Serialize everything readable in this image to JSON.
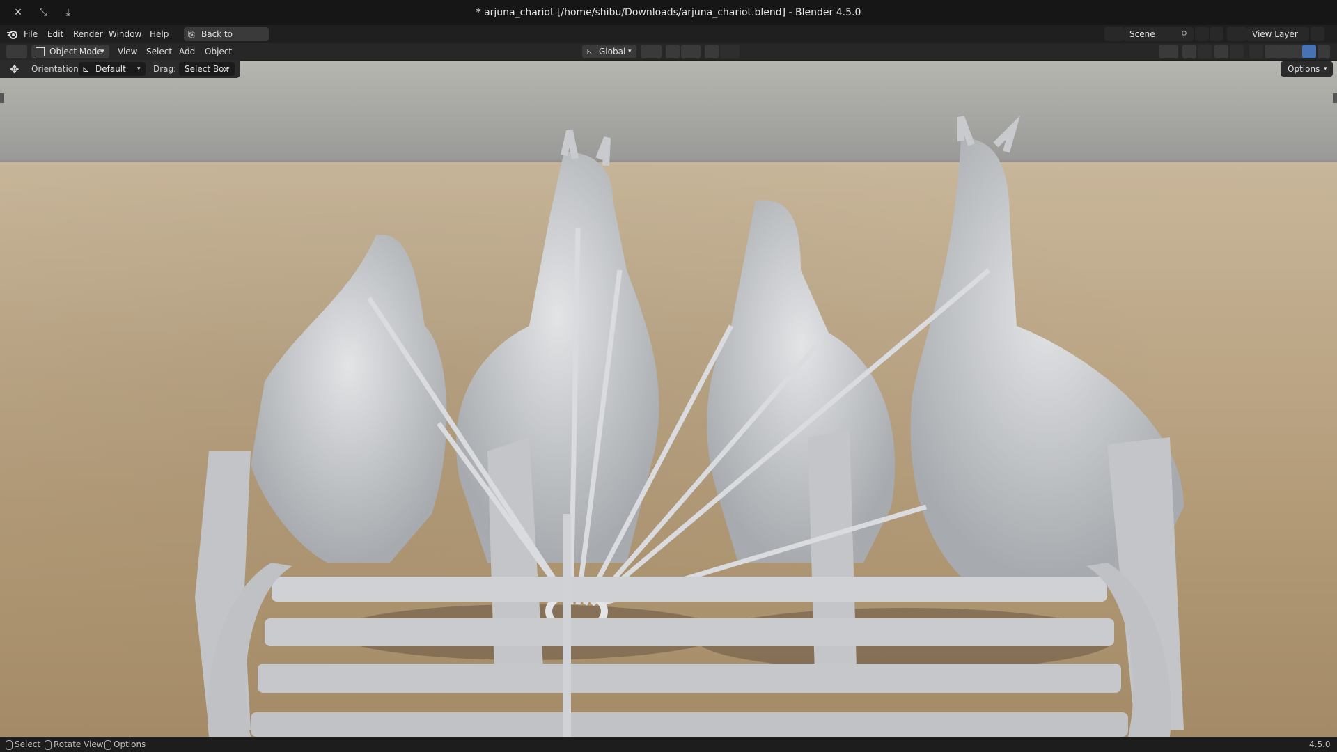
{
  "window": {
    "title": "* arjuna_chariot [/home/shibu/Downloads/arjuna_chariot.blend] - Blender 4.5.0"
  },
  "menu": {
    "items": [
      "File",
      "Edit",
      "Render",
      "Window",
      "Help"
    ],
    "back_button": "Back to Previous"
  },
  "scene": {
    "name": "Scene",
    "view_layer": "View Layer"
  },
  "header": {
    "mode": "Object Mode",
    "menus": [
      "View",
      "Select",
      "Add",
      "Object"
    ],
    "transform_orientation": "Global"
  },
  "tool_settings": {
    "orientation_label": "Orientation:",
    "orientation_value": "Default",
    "drag_label": "Drag:",
    "drag_value": "Select Box"
  },
  "options_label": "Options",
  "status": {
    "select": "Select",
    "rotate": "Rotate View",
    "options": "Options",
    "version": "4.5.0"
  },
  "icons": [
    "blender-logo-icon",
    "close-icon",
    "minimize-icon",
    "maximize-icon",
    "editor-type-icon",
    "move-tool-icon",
    "snap-icon",
    "proportional-icon",
    "shading-icon"
  ],
  "colors": {
    "titlebar": "#161616",
    "topbar": "#1f1f1f",
    "header": "#272727",
    "accent": "#4772b3",
    "ground": "#b39b78",
    "sky": "#a8a8a4"
  }
}
